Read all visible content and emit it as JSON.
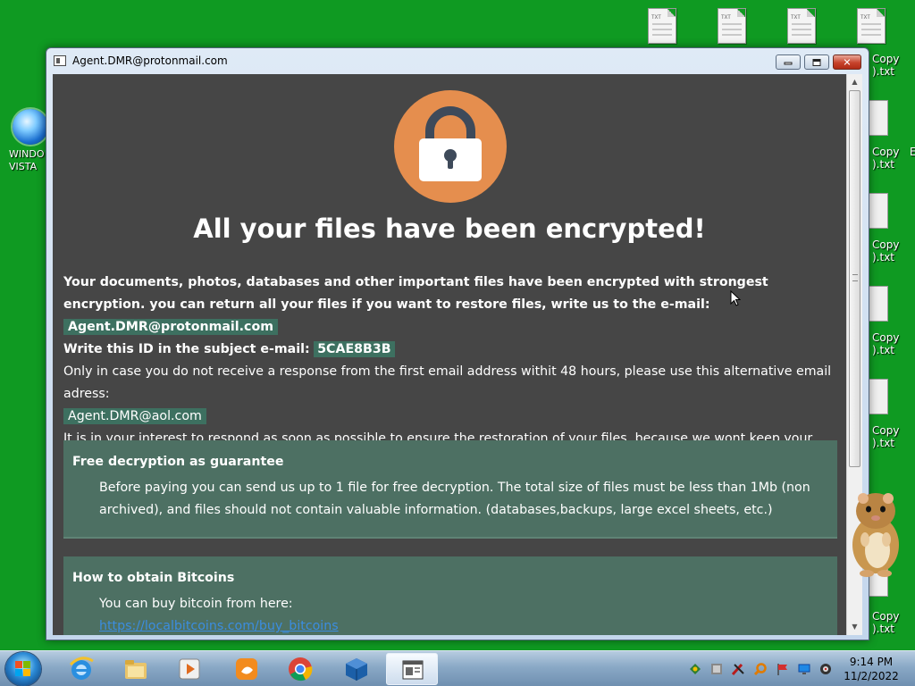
{
  "desktop": {
    "icons": [
      {
        "label": "WINDOWS VISTA",
        "display": "WINDO\nVISTA"
      },
      {
        "label": "Copy",
        "sub": ".txt"
      },
      {
        "label": "Copy",
        "sub": ".txt"
      },
      {
        "label": "Copy",
        "sub": ".txt"
      },
      {
        "label": "Copy",
        "sub": ".txt"
      },
      {
        "label": "Copy",
        "sub": ".txt"
      },
      {
        "label": "Copy",
        "sub": ".txt"
      }
    ],
    "top_doc_tag": "TXT",
    "right_labels": [
      "Copy",
      ").txt",
      "Copy",
      ").txt",
      "Copy",
      ").txt",
      "Copy",
      ").txt",
      "Copy",
      ").txt",
      "Copy",
      ").txt"
    ],
    "edge_char": "E"
  },
  "window": {
    "title": "Agent.DMR@protonmail.com",
    "controls": {
      "minimize": "",
      "maximize": "",
      "close": "✕"
    }
  },
  "ransom_note": {
    "headline": "All your files have been encrypted!",
    "intro_bold_1": "Your documents, photos, databases and other important files have been encrypted with strongest encryption. you can return all your files if you want to restore files, write us to the e-mail:",
    "primary_email": "Agent.DMR@protonmail.com",
    "id_label": "Write this ID in the subject e-mail:",
    "victim_id": "5CAE8B3B",
    "alt_text": "Only in case you do not receive a response from the first email address withit 48 hours, please use this alternative email adress:",
    "alt_email": "Agent.DMR@aol.com",
    "interest_text": "It is in your interest to respond as soon as possible to ensure the restoration of your files, because we wont keep your decryption keys at our server more than one week. The price depends on how fast you write to us.",
    "sections": [
      {
        "heading": "Free decryption as guarantee",
        "body": "Before paying you can send us up to 1 file for free decryption. The total size of files must be less than 1Mb (non archived), and files should not contain valuable information. (databases,backups, large excel sheets, etc.)"
      },
      {
        "heading": "How to obtain Bitcoins",
        "body": "You can buy bitcoin from here:",
        "link": "https://localbitcoins.com/buy_bitcoins"
      }
    ]
  },
  "taskbar": {
    "pinned": [
      "internet-explorer",
      "windows-explorer",
      "media-player",
      "uc-browser",
      "chrome",
      "virtualbox",
      "ransom-window"
    ],
    "tray": [
      "network-icon",
      "security-icon",
      "tool-icon",
      "search-icon",
      "flag-icon",
      "display-icon",
      "volume-icon"
    ],
    "time": "9:14 PM",
    "date": "11/2/2022"
  },
  "colors": {
    "desktop": "#0f9a22",
    "content_bg": "#464646",
    "lock_circle": "#e58e4e",
    "highlight": "#3d7060",
    "section_bg": "#4d7063",
    "link": "#3b8de0"
  }
}
